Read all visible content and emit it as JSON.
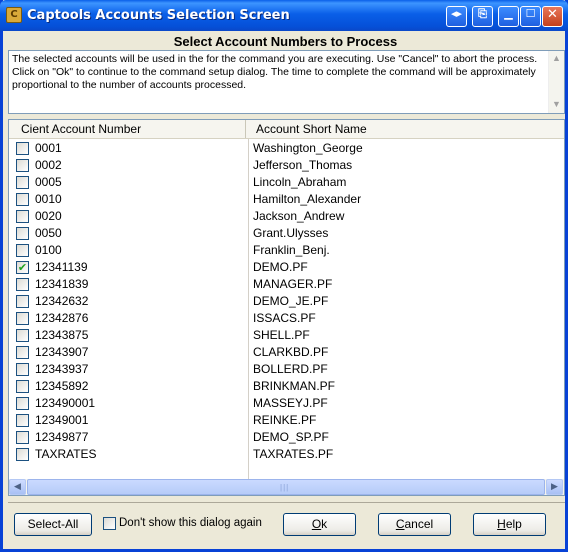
{
  "window": {
    "title": "Captools Accounts Selection Screen",
    "app_icon_glyph": "C",
    "title_buttons": [
      "resize-icon",
      "export-icon",
      "minimize-icon",
      "maximize-icon",
      "close-icon"
    ]
  },
  "header": {
    "title": "Select Account Numbers to Process"
  },
  "description": "The selected accounts will be used in the for the command you are executing.  Use \"Cancel\" to abort the process. Click on \"Ok\" to continue to the command setup dialog.  The time to complete the command will be approximately proportional to the number of accounts processed.",
  "list": {
    "columns": [
      "Cient Account Number",
      "Account Short Name"
    ],
    "rows": [
      {
        "number": "0001",
        "name": "Washington_George",
        "checked": false
      },
      {
        "number": "0002",
        "name": "Jefferson_Thomas",
        "checked": false
      },
      {
        "number": "0005",
        "name": "Lincoln_Abraham",
        "checked": false
      },
      {
        "number": "0010",
        "name": "Hamilton_Alexander",
        "checked": false
      },
      {
        "number": "0020",
        "name": "Jackson_Andrew",
        "checked": false
      },
      {
        "number": "0050",
        "name": "Grant.Ulysses",
        "checked": false
      },
      {
        "number": "0100",
        "name": "Franklin_Benj.",
        "checked": false
      },
      {
        "number": "12341139",
        "name": "DEMO.PF",
        "checked": true
      },
      {
        "number": "12341839",
        "name": "MANAGER.PF",
        "checked": false
      },
      {
        "number": "12342632",
        "name": "DEMO_JE.PF",
        "checked": false
      },
      {
        "number": "12342876",
        "name": "ISSACS.PF",
        "checked": false
      },
      {
        "number": "12343875",
        "name": "SHELL.PF",
        "checked": false
      },
      {
        "number": "12343907",
        "name": "CLARKBD.PF",
        "checked": false
      },
      {
        "number": "12343937",
        "name": "BOLLERD.PF",
        "checked": false
      },
      {
        "number": "12345892",
        "name": "BRINKMAN.PF",
        "checked": false
      },
      {
        "number": "123490001",
        "name": "MASSEYJ.PF",
        "checked": false
      },
      {
        "number": "12349001",
        "name": "REINKE.PF",
        "checked": false
      },
      {
        "number": "12349877",
        "name": "DEMO_SP.PF",
        "checked": false
      },
      {
        "number": "TAXRATES",
        "name": "TAXRATES.PF",
        "checked": false
      }
    ]
  },
  "footer": {
    "select_all": "Select-All",
    "dont_show": "Don't show this dialog again",
    "ok_key": "O",
    "ok_rest": "k",
    "cancel_key": "C",
    "cancel_rest": "ancel",
    "help_key": "H",
    "help_rest": "elp"
  },
  "colors": {
    "title_blue": "#0a5fe8",
    "check_green": "#21a121"
  }
}
